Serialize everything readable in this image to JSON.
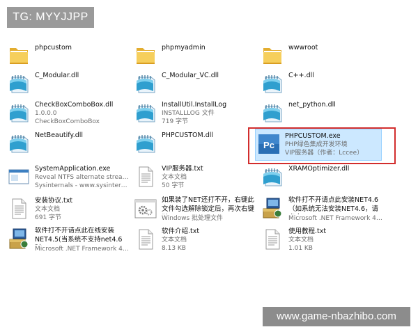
{
  "overlay": {
    "tag": "TG: MYYJJPP",
    "watermark": "www.game-nbazhibo.com"
  },
  "colors": {
    "selection": "#cce8ff",
    "highlight_border": "#d22d2d",
    "folder": "#f3c54a"
  },
  "files": [
    {
      "name": "phpcustom",
      "icon": "folder-icon"
    },
    {
      "name": "phpmyadmin",
      "icon": "folder-icon"
    },
    {
      "name": "wwwroot",
      "icon": "folder-icon"
    },
    {
      "name": "C_Modular.dll",
      "icon": "notepad-icon"
    },
    {
      "name": "C_Modular_VC.dll",
      "icon": "notepad-icon"
    },
    {
      "name": "C++.dll",
      "icon": "notepad-icon"
    },
    {
      "name": "CheckBoxComboBox.dll",
      "line2": "1.0.0.0",
      "line3": "CheckBoxComboBox",
      "icon": "notepad-icon"
    },
    {
      "name": "InstallUtil.InstallLog",
      "line2": "INSTALLLOG 文件",
      "line3": "719 字节",
      "icon": "notepad-icon"
    },
    {
      "name": "net_python.dll",
      "icon": "notepad-icon"
    },
    {
      "name": "NetBeautify.dll",
      "icon": "notepad-icon"
    },
    {
      "name": "PHPCUSTOM.dll",
      "icon": "notepad-icon"
    },
    {
      "name": "PHPCUSTOM.exe",
      "line2": "PHP绿色集成开发环境",
      "line3": "VIP服务器（作者：Lccee）",
      "icon": "php-app-icon",
      "selected": true
    },
    {
      "name": "SystemApplication.exe",
      "line2": "Reveal NTFS alternate streams.",
      "line3": "Sysinternals - www.sysinternals....",
      "icon": "window-app-icon"
    },
    {
      "name": "VIP服务器.txt",
      "line2": "文本文档",
      "line3": "50 字节",
      "icon": "text-file-icon"
    },
    {
      "name": "XRAMOptimizer.dll",
      "icon": "notepad-icon"
    },
    {
      "name": "安装协议.txt",
      "line2": "文本文档",
      "line3": "691 字节",
      "icon": "text-file-icon"
    },
    {
      "name": "如果装了NET还打不开，右键此文件勾选解除锁定后，再次右键以...",
      "line3": "Windows 批处理文件",
      "icon": "batch-gear-icon"
    },
    {
      "name": "软件打不开请点此安装NET4.6（如系统无法安装NET4.6，请点击NE...",
      "line3": "Microsoft .NET Framework 4.6...",
      "icon": "installer-icon"
    },
    {
      "name": "软件打不开请点此在线安装NET4.5(当系统不支持net4.6时，...",
      "line3": "Microsoft .NET Framework 4.5...",
      "icon": "installer-icon"
    },
    {
      "name": "软件介绍.txt",
      "line2": "文本文档",
      "line3": "8.13 KB",
      "icon": "text-file-icon"
    },
    {
      "name": "使用教程.txt",
      "line2": "文本文档",
      "line3": "1.01 KB",
      "icon": "text-file-icon"
    }
  ]
}
